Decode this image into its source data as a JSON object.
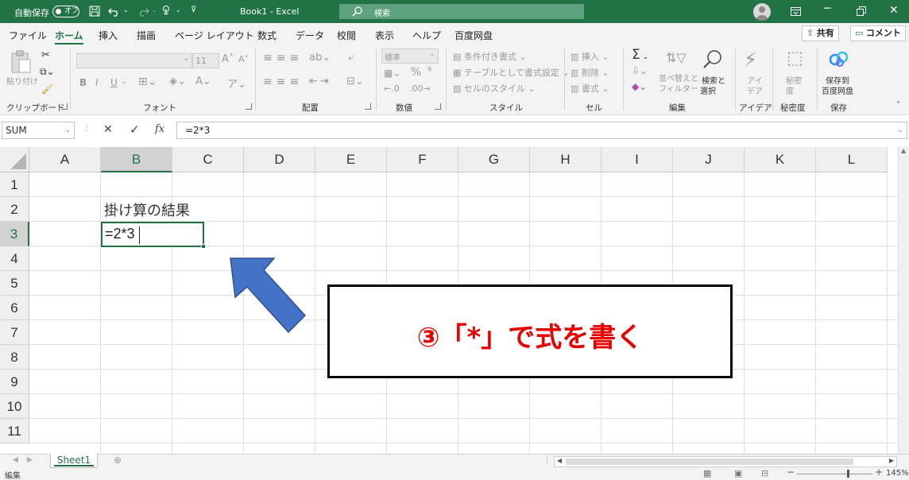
{
  "title_bar": {
    "autosave_label": "自動保存",
    "autosave_state": "オフ",
    "doc_title": "Book1  -  Excel",
    "search_placeholder": "検索",
    "accent_color": "#217346"
  },
  "tabs": [
    "ファイル",
    "ホーム",
    "挿入",
    "描画",
    "ページ レイアウト",
    "数式",
    "データ",
    "校閲",
    "表示",
    "ヘルプ",
    "百度网盘"
  ],
  "active_tab": "ホーム",
  "share_label": "共有",
  "comment_label": "コメント",
  "ribbon": {
    "clipboard": {
      "paste": "貼り付け",
      "label": "クリップボード"
    },
    "font": {
      "size": "11",
      "bold": "B",
      "italic": "I",
      "underline": "U",
      "label": "フォント"
    },
    "alignment": {
      "label": "配置"
    },
    "number": {
      "format": "標準",
      "percent": "%",
      "label": "数値"
    },
    "styles": {
      "conditional": "条件付き書式",
      "table": "テーブルとして書式設定",
      "cell_styles": "セルのスタイル",
      "label": "スタイル"
    },
    "cells": {
      "insert": "挿入",
      "delete": "削除",
      "format": "書式",
      "label": "セル"
    },
    "editing": {
      "sum": "Σ",
      "sort": "並べ替えと\nフィルター",
      "find_l1": "検索と",
      "find_l2": "選択",
      "label": "編集"
    },
    "ideas": {
      "l1": "アイ",
      "l2": "デア",
      "label": "アイデア"
    },
    "sensitivity": {
      "l1": "秘密",
      "l2": "度",
      "label": "秘密度"
    },
    "save": {
      "l1": "保存到",
      "l2": "百度网盘",
      "label": "保存"
    }
  },
  "formula_bar": {
    "name_box": "SUM",
    "cancel": "✕",
    "enter": "✓",
    "fx": "fx",
    "formula": "=2*3"
  },
  "grid": {
    "columns": [
      "A",
      "B",
      "C",
      "D",
      "E",
      "F",
      "G",
      "H",
      "I",
      "J",
      "K",
      "L"
    ],
    "rows": [
      "1",
      "2",
      "3",
      "4",
      "5",
      "6",
      "7",
      "8",
      "9",
      "10",
      "11"
    ],
    "B2": "掛け算の結果",
    "B3": "=2*3"
  },
  "annotation": {
    "text": "③「*」で式を書く",
    "arrow_color": "#4472c4",
    "text_color": "#e60000"
  },
  "sheet_tab": "Sheet1",
  "status": {
    "mode": "編集",
    "zoom": "145%"
  }
}
